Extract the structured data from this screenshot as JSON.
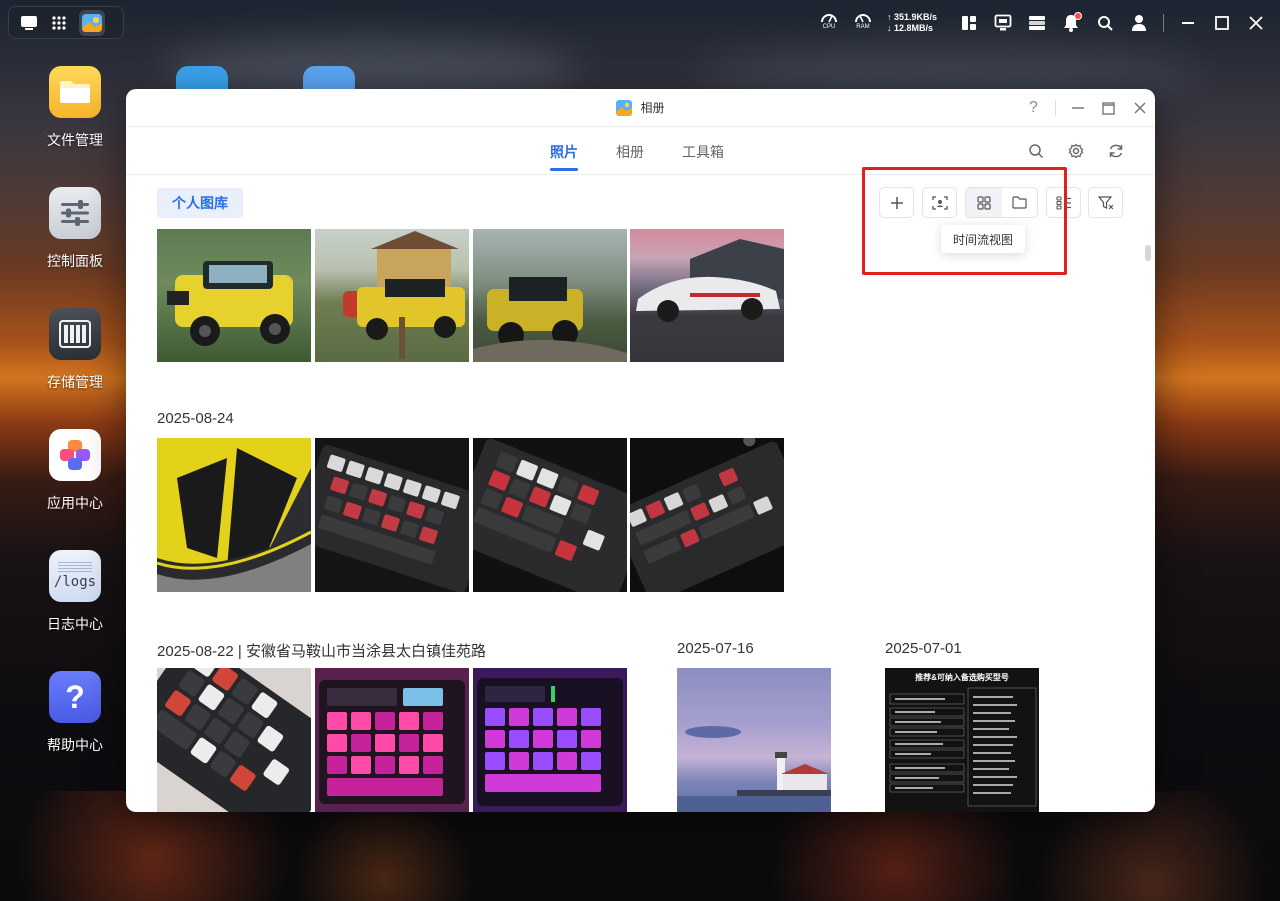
{
  "topbar": {
    "cpu_label": "CPU",
    "ram_label": "RAM",
    "upload_speed": "351.9KB/s",
    "download_speed": "12.8MB/s"
  },
  "desktop": {
    "icons": [
      {
        "label": "文件管理",
        "icon": "folder-icon"
      },
      {
        "label": "控制面板",
        "icon": "sliders-icon"
      },
      {
        "label": "存储管理",
        "icon": "storage-icon"
      },
      {
        "label": "应用中心",
        "icon": "apps-icon"
      },
      {
        "label": "日志中心",
        "icon": "logs-icon",
        "icon_text": "/logs"
      },
      {
        "label": "帮助中心",
        "icon": "help-icon",
        "icon_text": "?"
      }
    ]
  },
  "window": {
    "title": "相册",
    "help_glyph": "?",
    "tabs": [
      {
        "label": "照片",
        "active": true
      },
      {
        "label": "相册",
        "active": false
      },
      {
        "label": "工具箱",
        "active": false
      }
    ],
    "library_tag": "个人图库",
    "tooltip": "时间流视图",
    "groups": [
      {
        "date": "2025-08-24"
      },
      {
        "date": "2025-08-22 | 安徽省马鞍山市当涂县太白镇佳苑路"
      },
      {
        "date": "2025-07-16"
      },
      {
        "date": "2025-07-01"
      }
    ],
    "doc_thumbnail_title": "推荐&可纳入备选购买型号",
    "colors": {
      "accent": "#2a6fe6",
      "highlight_box": "#e02020"
    }
  }
}
